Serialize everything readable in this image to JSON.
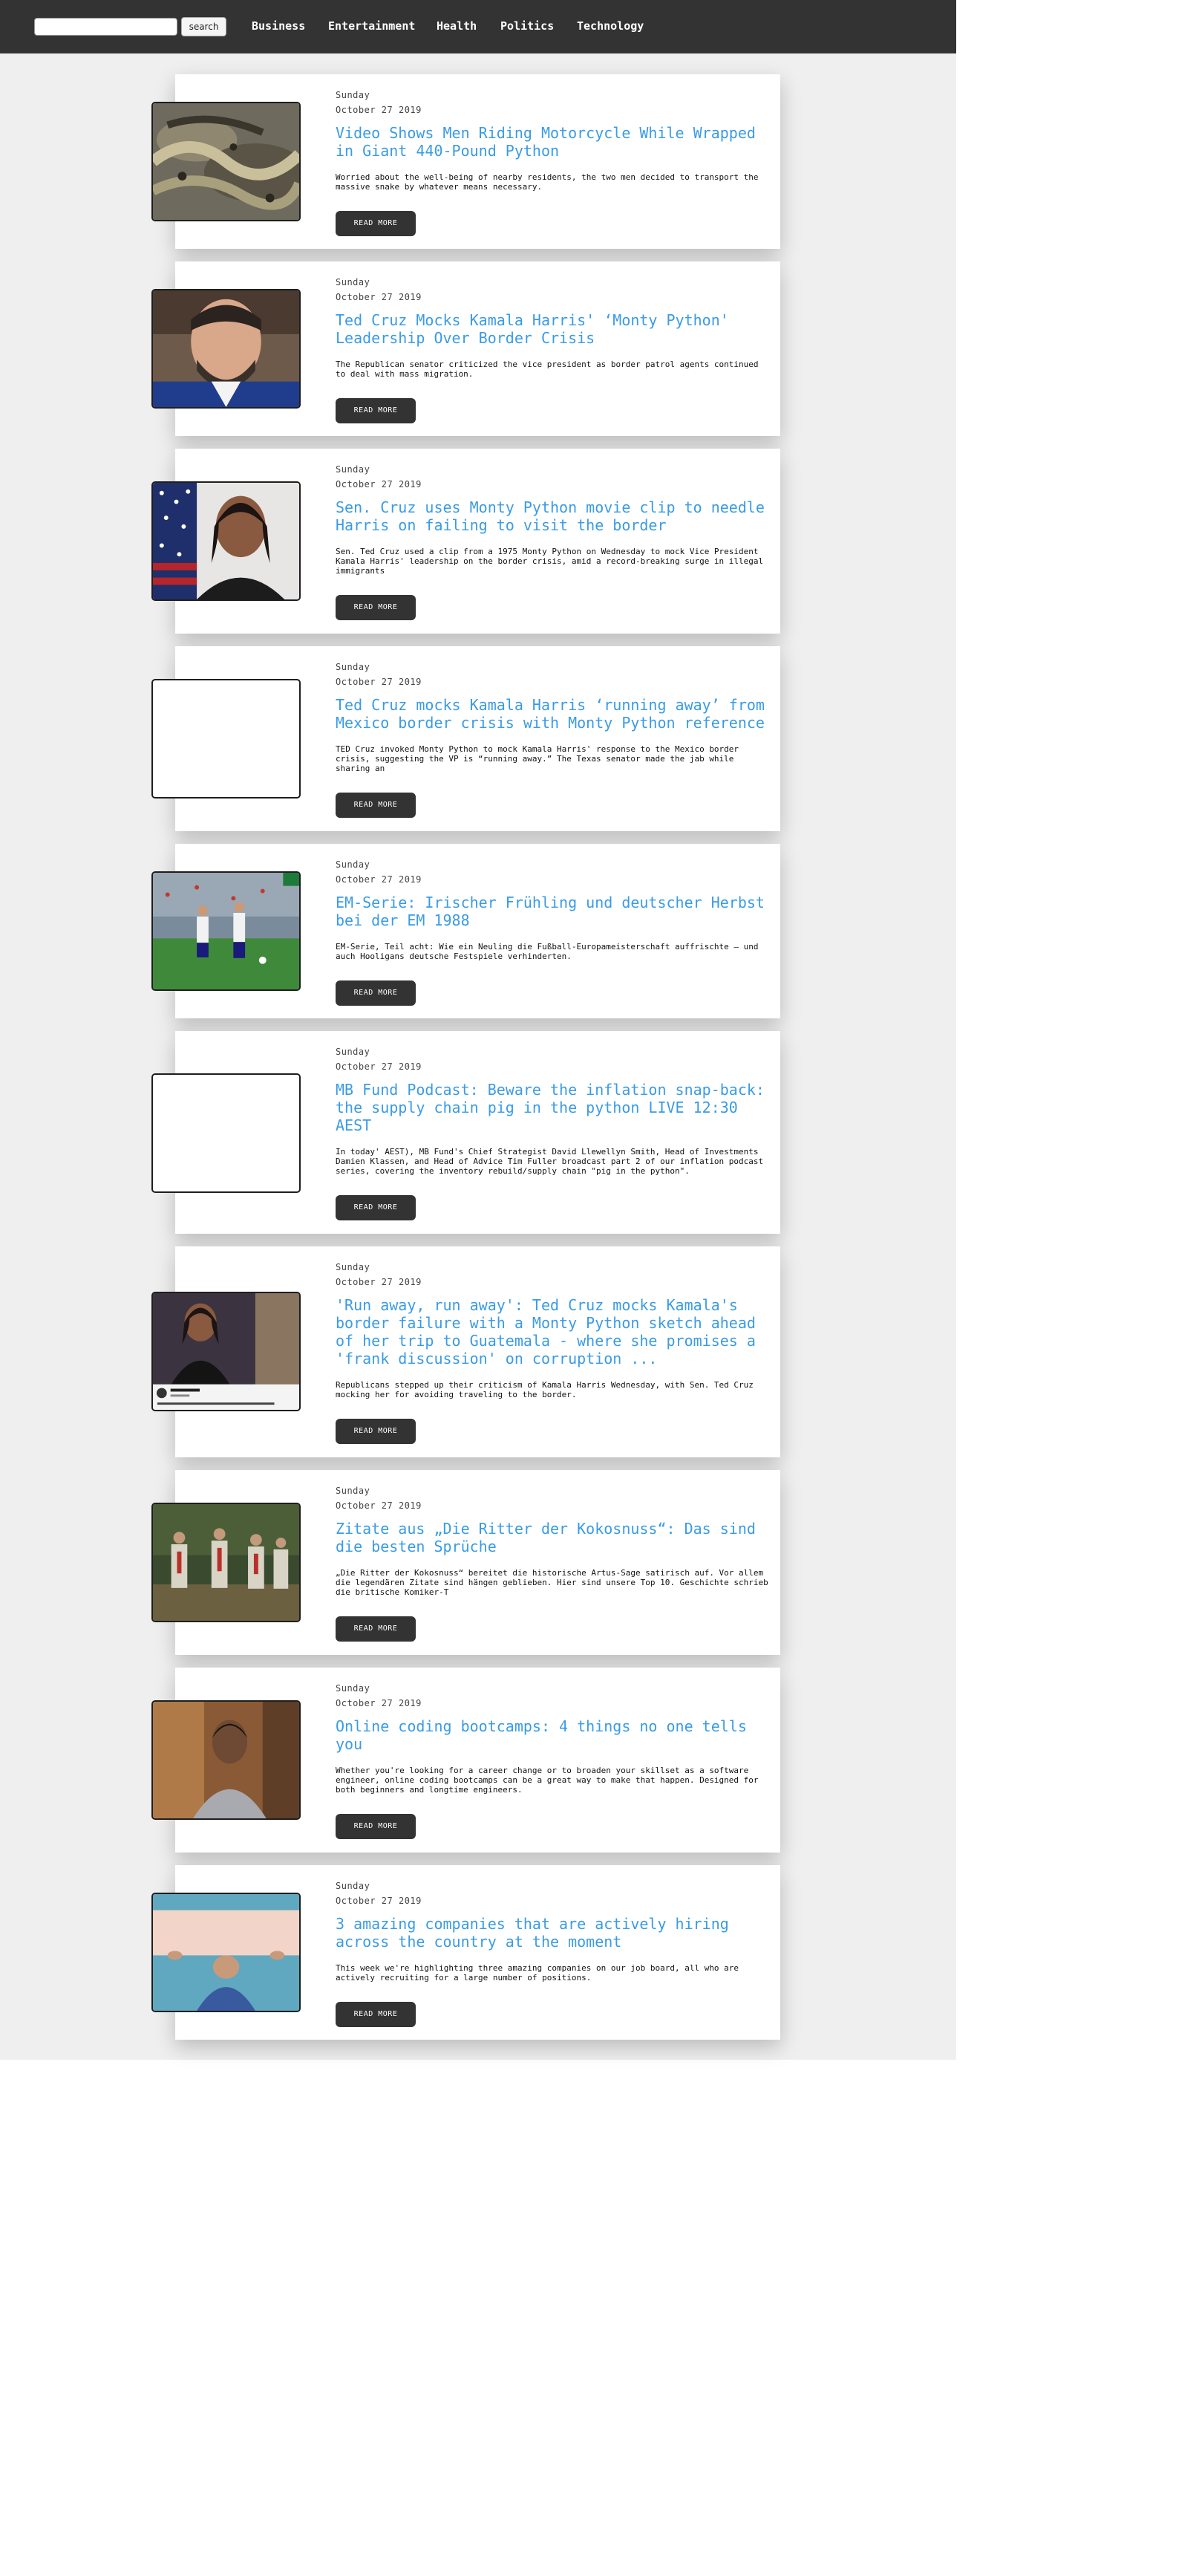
{
  "header": {
    "search_placeholder": "",
    "search_button": "search",
    "nav": [
      "Business",
      "Entertainment",
      "Health",
      "Politics",
      "Technology"
    ]
  },
  "articles": [
    {
      "day": "Sunday",
      "date": "October 27 2019",
      "title": "Video Shows Men Riding Motorcycle While Wrapped in Giant 440-Pound Python",
      "excerpt": "Worried about the well-being of nearby residents, the two men decided to transport the massive snake by whatever means necessary.",
      "button": "READ MORE"
    },
    {
      "day": "Sunday",
      "date": "October 27 2019",
      "title": "Ted Cruz Mocks Kamala Harris' ‘Monty Python' Leadership Over Border Crisis",
      "excerpt": "The Republican senator criticized the vice president as border patrol agents continued to deal with mass migration.",
      "button": "READ MORE"
    },
    {
      "day": "Sunday",
      "date": "October 27 2019",
      "title": "Sen. Cruz uses Monty Python movie clip to needle Harris on failing to visit the border",
      "excerpt": "Sen. Ted Cruz used a clip from a 1975 Monty Python on Wednesday to mock Vice President Kamala Harris' leadership on the border crisis, amid a record-breaking surge in illegal immigrants",
      "button": "READ MORE"
    },
    {
      "day": "Sunday",
      "date": "October 27 2019",
      "title": "Ted Cruz mocks Kamala Harris ‘running away’ from Mexico border crisis with Monty Python reference",
      "excerpt": "TED Cruz invoked Monty Python to mock Kamala Harris' response to the Mexico border crisis, suggesting the VP is “running away.” The Texas senator made the jab while sharing an",
      "button": "READ MORE"
    },
    {
      "day": "Sunday",
      "date": "October 27 2019",
      "title": "EM-Serie: Irischer Frühling und deutscher Herbst bei der EM 1988",
      "excerpt": "EM-Serie, Teil acht: Wie ein Neuling die Fußball-Europameisterschaft auffrischte – und auch Hooligans deutsche Festspiele verhinderten.",
      "button": "READ MORE"
    },
    {
      "day": "Sunday",
      "date": "October 27 2019",
      "title": "MB Fund Podcast: Beware the inflation snap-back: the supply chain pig in the python LIVE 12:30 AEST",
      "excerpt": "In today' AEST), MB Fund's Chief Strategist David Llewellyn Smith, Head of Investments Damien Klassen, and Head of Advice Tim Fuller broadcast part 2 of our inflation podcast series, covering the inventory rebuild/supply chain \"pig in the python\".",
      "button": "READ MORE"
    },
    {
      "day": "Sunday",
      "date": "October 27 2019",
      "title": "'Run away, run away': Ted Cruz mocks Kamala's border failure with a Monty Python sketch ahead of her trip to Guatemala - where she promises a 'frank discussion' on corruption ...",
      "excerpt": "Republicans stepped up their criticism of Kamala Harris Wednesday, with Sen. Ted Cruz mocking her for avoiding traveling to the border.",
      "button": "READ MORE"
    },
    {
      "day": "Sunday",
      "date": "October 27 2019",
      "title": "Zitate aus „Die Ritter der Kokosnuss“: Das sind die besten Sprüche",
      "excerpt": "„Die Ritter der Kokosnuss“ bereitet die historische Artus-Sage satirisch auf. Vor allem die legendären Zitate sind hängen geblieben. Hier sind unsere Top 10. Geschichte schrieb die britische Komiker-T",
      "button": "READ MORE"
    },
    {
      "day": "Sunday",
      "date": "October 27 2019",
      "title": "Online coding bootcamps: 4 things no one tells you",
      "excerpt": "Whether you're looking for a career change or to broaden your skillset as a software engineer, online coding bootcamps can be a great way to make that happen. Designed for both beginners and longtime engineers.",
      "button": "READ MORE"
    },
    {
      "day": "Sunday",
      "date": "October 27 2019",
      "title": "3 amazing companies that are actively hiring across the country at the moment",
      "excerpt": "This week we're highlighting three amazing companies on our job board, all who are actively recruiting for a large number of positions.",
      "button": "READ MORE"
    }
  ]
}
